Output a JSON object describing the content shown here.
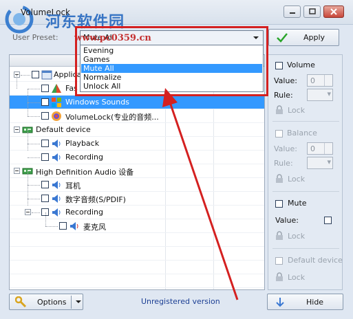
{
  "window": {
    "title": "VolumeLock"
  },
  "watermark": {
    "site_cn": "河东软件园",
    "url": "www.pc0359.cn"
  },
  "preset": {
    "label": "User Preset:",
    "selected": "Mute All",
    "options": [
      "Evening",
      "Games",
      "Mute All",
      "Normalize",
      "Unlock All"
    ],
    "highlighted": "Mute All",
    "apply_label": "Apply"
  },
  "tree": {
    "rows": [
      {
        "label": "Applications",
        "visible_label": "Applica"
      },
      {
        "label": "Fast",
        "visible_label": "Fas"
      },
      {
        "label": "Windows Sounds"
      },
      {
        "label": "VolumeLock(专业的音频..."
      },
      {
        "label": "Default device"
      },
      {
        "label": "Playback"
      },
      {
        "label": "Recording"
      },
      {
        "label": "High Definition Audio 设备"
      },
      {
        "label": "耳机"
      },
      {
        "label": "数字音频(S/PDIF)"
      },
      {
        "label": "Recording"
      },
      {
        "label": "麦克风"
      }
    ]
  },
  "right_panel": {
    "volume": {
      "label": "Volume",
      "value_label": "Value:",
      "value": "0",
      "rule_label": "Rule:",
      "lock": "Lock"
    },
    "balance": {
      "label": "Balance",
      "value_label": "Value:",
      "value": "0",
      "rule_label": "Rule:",
      "lock": "Lock"
    },
    "mute": {
      "label": "Mute",
      "value_label": "Value:",
      "lock": "Lock"
    },
    "default_device": {
      "label": "Default device",
      "lock": "Lock"
    }
  },
  "bottom": {
    "options_label": "Options",
    "status": "Unregistered version",
    "hide_label": "Hide"
  },
  "colors": {
    "selection": "#3399ff",
    "annotation": "#d42020",
    "link_blue": "#1c3f94"
  }
}
